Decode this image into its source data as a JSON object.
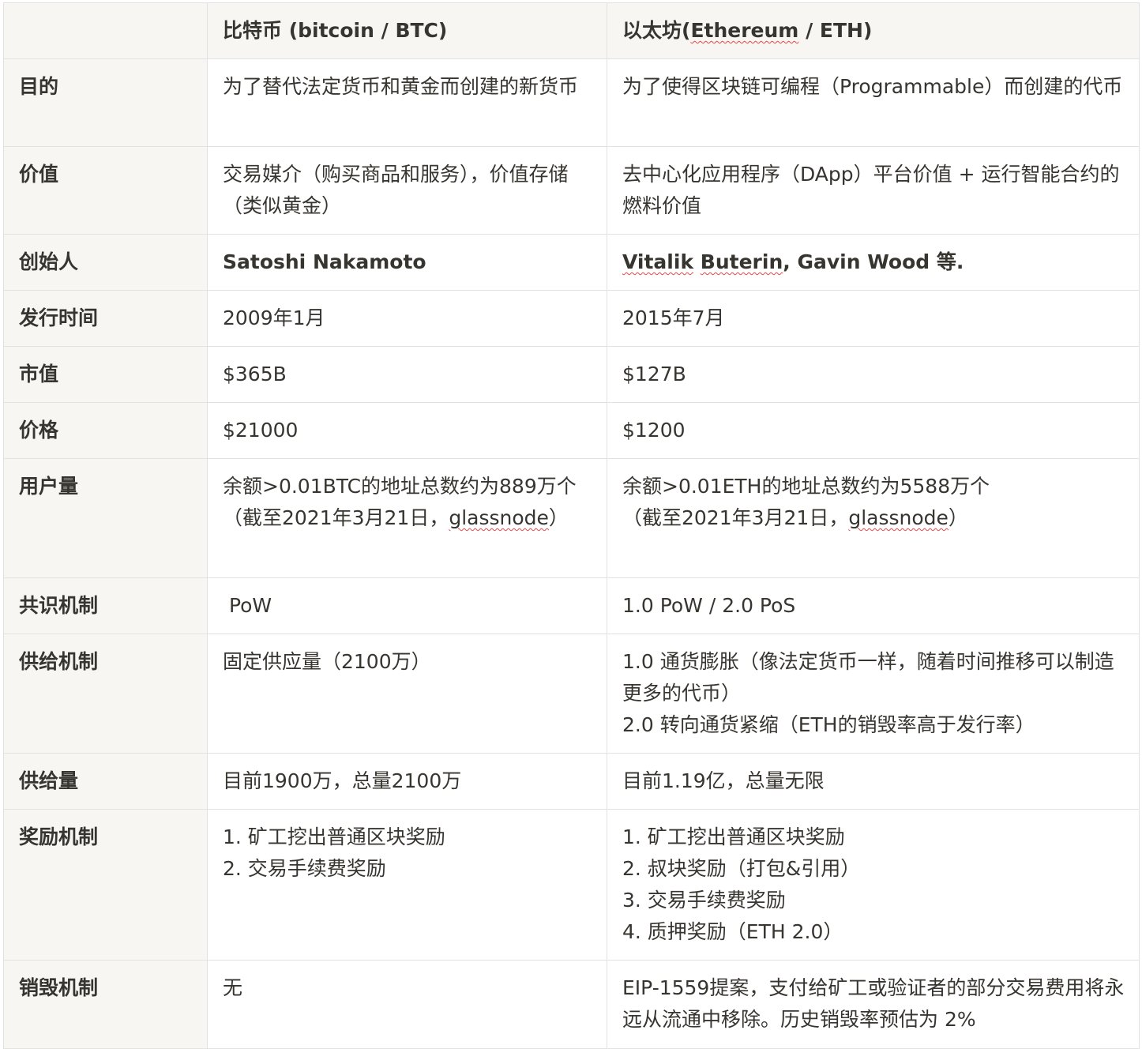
{
  "table": {
    "headers": {
      "col0": "",
      "col1": "比特币 (bitcoin / BTC)",
      "col2_prefix": "以太坊(",
      "col2_word": "Ethereum",
      "col2_suffix": " / ETH)"
    },
    "rows": {
      "purpose": {
        "label": "目的",
        "btc": "为了替代法定货币和黄金而创建的新货币",
        "eth": "为了使得区块链可编程（Programmable）而创建的代币"
      },
      "value": {
        "label": "价值",
        "btc": "交易媒介（购买商品和服务），价值存储（类似黄金）",
        "eth": "去中心化应用程序（DApp）平台价值 + 运行智能合约的燃料价值"
      },
      "founder": {
        "label": "创始人",
        "btc": "Satoshi Nakamoto",
        "eth_name1": "Vitalik",
        "eth_space": " ",
        "eth_name2": "Buterin",
        "eth_rest": ", Gavin Wood 等."
      },
      "launch": {
        "label": "发行时间",
        "btc": "2009年1月",
        "eth": "2015年7月"
      },
      "market_cap": {
        "label": "市值",
        "btc": "$365B",
        "eth": "$127B"
      },
      "price": {
        "label": "价格",
        "btc": "$21000",
        "eth": "$1200"
      },
      "users": {
        "label": "用户量",
        "btc_line1": "余额>0.01BTC的地址总数约为889万个",
        "btc_line2_prefix": "（截至2021年3月21日，",
        "btc_source": "glassnode",
        "btc_line2_suffix": "）",
        "eth_line1": "余额>0.01ETH的地址总数约为5588万个",
        "eth_line2_prefix": "（截至2021年3月21日，",
        "eth_source": "glassnode",
        "eth_line2_suffix": "）"
      },
      "consensus": {
        "label": "共识机制",
        "btc": " PoW",
        "eth": "1.0 PoW / 2.0 PoS"
      },
      "supply_mechanism": {
        "label": "供给机制",
        "btc": "固定供应量（2100万）",
        "eth_line1": "1.0 通货膨胀（像法定货币一样，随着时间推移可以制造更多的代币）",
        "eth_line2": "2.0 转向通货紧缩（ETH的销毁率高于发行率）"
      },
      "supply": {
        "label": "供给量",
        "btc": "目前1900万，总量2100万",
        "eth": "目前1.19亿，总量无限"
      },
      "reward": {
        "label": "奖励机制",
        "btc_items": [
          "1. 矿工挖出普通区块奖励",
          "2. 交易手续费奖励"
        ],
        "eth_items": [
          "1. 矿工挖出普通区块奖励",
          "2. 叔块奖励（打包&引用）",
          "3. 交易手续费奖励",
          "4. 质押奖励（ETH 2.0）"
        ]
      },
      "burn": {
        "label": "销毁机制",
        "btc": "无",
        "eth": "EIP-1559提案，支付给矿工或验证者的部分交易费用将永远从流通中移除。历史销毁率预估为 2%"
      }
    }
  },
  "colors": {
    "label_background": "#f7f6f3",
    "border": "#e3e2e0",
    "text": "#37352f",
    "spellcheck_underline": "#e64747"
  }
}
